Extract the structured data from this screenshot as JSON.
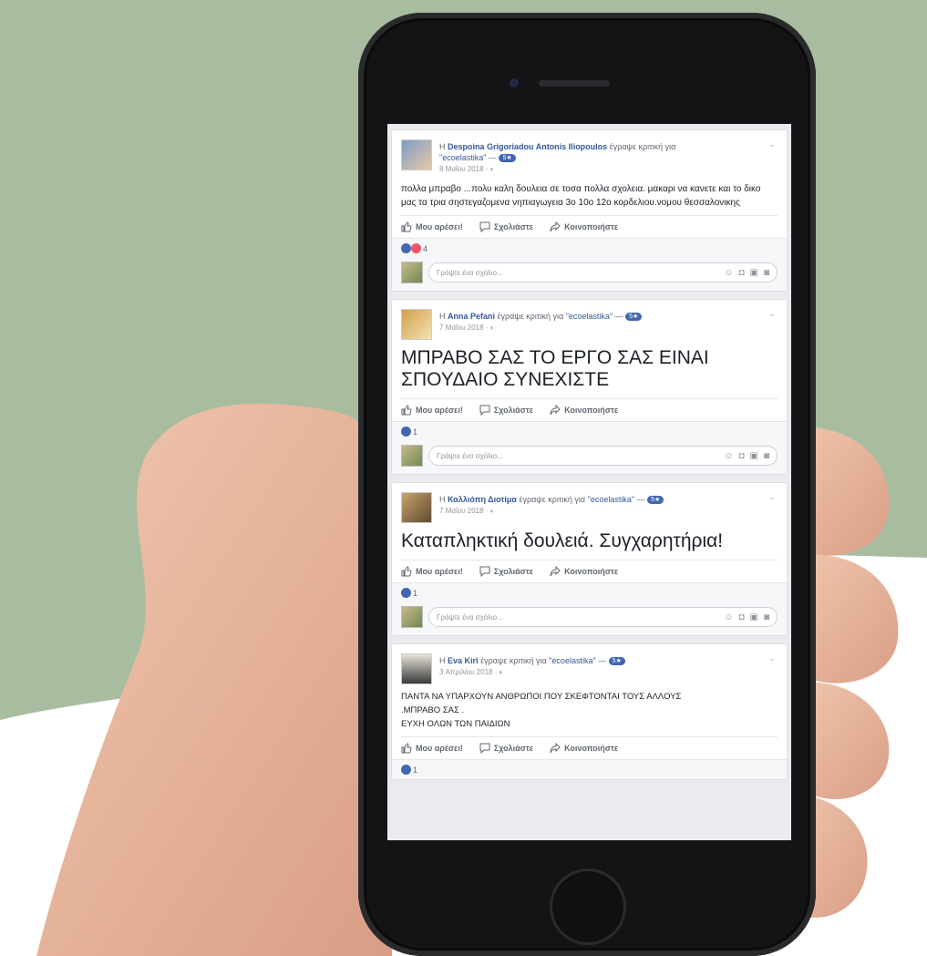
{
  "background": {
    "green": "#a8bca0",
    "white": "#ffffff"
  },
  "actions": {
    "like": "Μου αρέσει!",
    "comment": "Σχολιάστε",
    "share": "Κοινοποιήστε"
  },
  "comment_placeholder": "Γράψτε ένα σχόλιο...",
  "posts": [
    {
      "prefix": "Η",
      "author": "Despoina Grigoriadou Antonis Iliopoulos",
      "wrote": "έγραψε κριτική για",
      "page": "\"ecoelastika\"",
      "badge": "5★",
      "date": "8 Μαΐου 2018 · ◐",
      "text": "πολλα μπραβο ...πολυ καλη δουλεια σε τοσα πολλα σχολεια. μακαρι να κανετε και το δικο μας τα τρια σηστεγαζομενα νηπιαγωγεια 3ο 10ο 12ο κορδελιου.νομου θεσσαλονικης",
      "reactions_count": "4"
    },
    {
      "prefix": "Η",
      "author": "Anna Pefani",
      "wrote": "έγραψε κριτική για",
      "page": "\"ecoelastika\"",
      "badge": "5★",
      "date": "7 Μαΐου 2018 · ◐",
      "text": "ΜΠΡΑΒΟ ΣΑΣ ΤΟ ΕΡΓΟ ΣΑΣ ΕΙΝΑΙ ΣΠΟΥΔΑΙΟ ΣΥΝΕΧΙΣΤΕ",
      "reactions_count": "1"
    },
    {
      "prefix": "Η",
      "author": "Καλλιόπη Διοτίμα",
      "wrote": "έγραψε κριτική για",
      "page": "\"ecoelastika\"",
      "badge": "5★",
      "date": "7 Μαΐου 2018 · ◐",
      "text": "Καταπληκτική δουλειά. Συγχαρητήρια!",
      "reactions_count": "1"
    },
    {
      "prefix": "Η",
      "author": "Eva Kiri",
      "wrote": "έγραψε κριτική για",
      "page": "\"ecoelastika\"",
      "badge": "5★",
      "date": "3 Απριλίου 2018 · ◐",
      "text_lines": [
        "ΠΑΝΤΑ ΝΑ ΥΠΑΡΧΟΥΝ ΑΝΘΡΩΠΟΙ ΠΟΥ ΣΚΕΦΤΟΝΤΑΙ ΤΟΥΣ ΑΛΛΟΥΣ",
        ".ΜΠΡΑΒΟ ΣΑΣ .",
        "ΕΥΧΗ ΟΛΩΝ ΤΩΝ ΠΑΙΔΙΩΝ"
      ],
      "reactions_count": "1"
    }
  ]
}
